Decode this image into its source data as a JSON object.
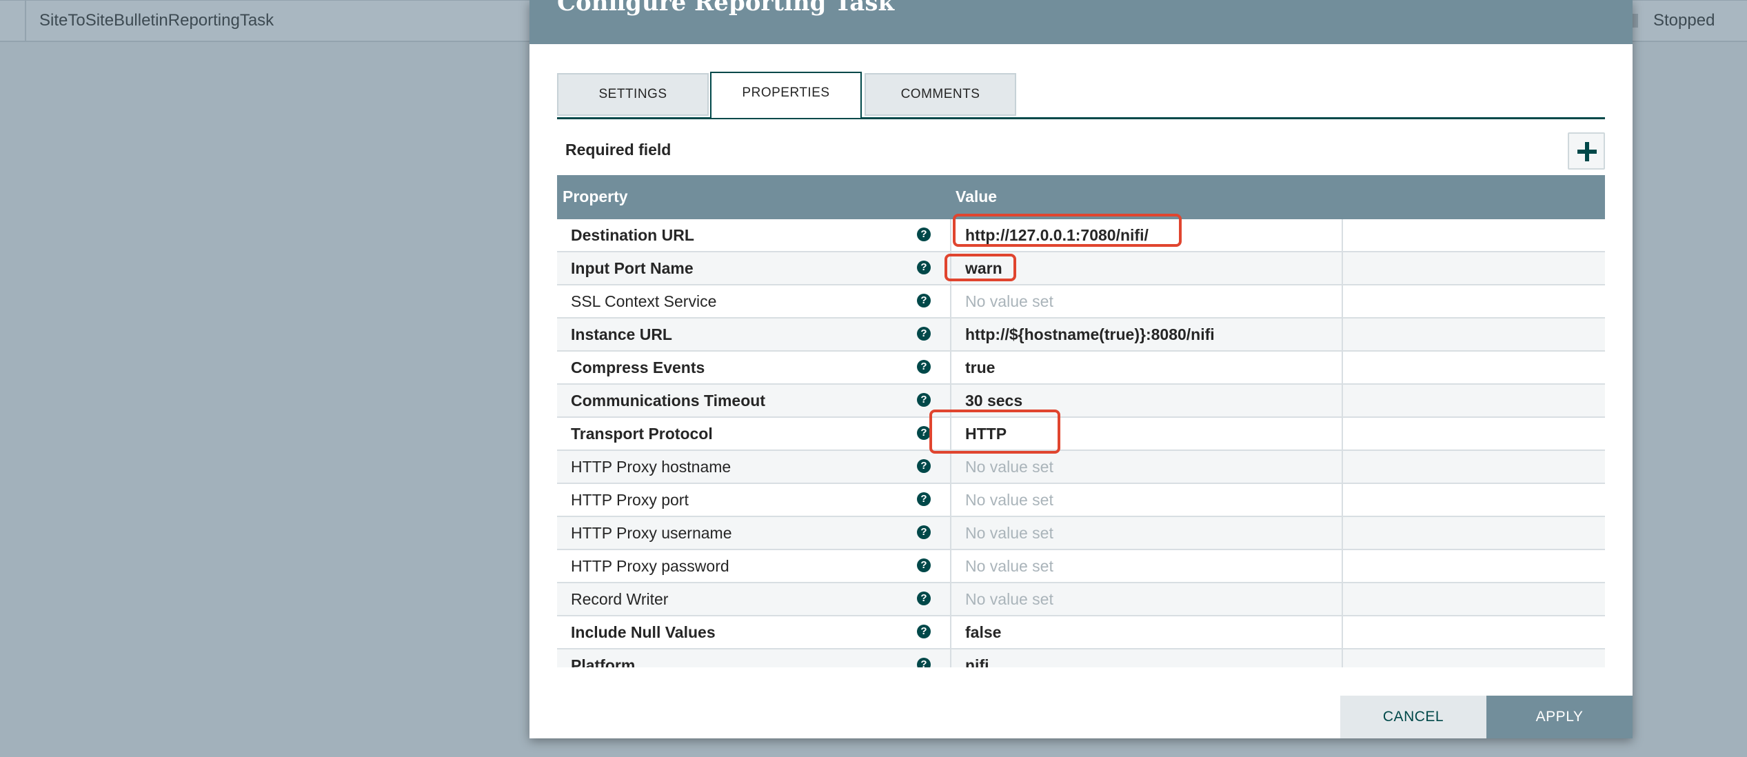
{
  "background": {
    "task_name": "SiteToSiteBulletinReportingTask",
    "task_status": "Stopped"
  },
  "dialog": {
    "title": "Configure Reporting Task",
    "tabs": [
      {
        "label": "SETTINGS",
        "active": false
      },
      {
        "label": "PROPERTIES",
        "active": true
      },
      {
        "label": "COMMENTS",
        "active": false
      }
    ],
    "required_field_label": "Required field",
    "add_property_icon": "plus-icon",
    "table": {
      "headers": {
        "property": "Property",
        "value": "Value"
      },
      "rows": [
        {
          "property": "Destination URL",
          "required": true,
          "value": "http://127.0.0.1:7080/nifi/",
          "set": true
        },
        {
          "property": "Input Port Name",
          "required": true,
          "value": "warn",
          "set": true
        },
        {
          "property": "SSL Context Service",
          "required": false,
          "value": "No value set",
          "set": false
        },
        {
          "property": "Instance URL",
          "required": true,
          "value": "http://${hostname(true)}:8080/nifi",
          "set": true
        },
        {
          "property": "Compress Events",
          "required": true,
          "value": "true",
          "set": true
        },
        {
          "property": "Communications Timeout",
          "required": true,
          "value": "30 secs",
          "set": true
        },
        {
          "property": "Transport Protocol",
          "required": true,
          "value": "HTTP",
          "set": true
        },
        {
          "property": "HTTP Proxy hostname",
          "required": false,
          "value": "No value set",
          "set": false
        },
        {
          "property": "HTTP Proxy port",
          "required": false,
          "value": "No value set",
          "set": false
        },
        {
          "property": "HTTP Proxy username",
          "required": false,
          "value": "No value set",
          "set": false
        },
        {
          "property": "HTTP Proxy password",
          "required": false,
          "value": "No value set",
          "set": false
        },
        {
          "property": "Record Writer",
          "required": false,
          "value": "No value set",
          "set": false
        },
        {
          "property": "Include Null Values",
          "required": true,
          "value": "false",
          "set": true
        },
        {
          "property": "Platform",
          "required": true,
          "value": "nifi",
          "set": true
        }
      ]
    },
    "buttons": {
      "cancel": "CANCEL",
      "apply": "APPLY"
    },
    "colors": {
      "header": "#728e9b",
      "accent": "#004849",
      "annotation": "#e0452f"
    }
  }
}
